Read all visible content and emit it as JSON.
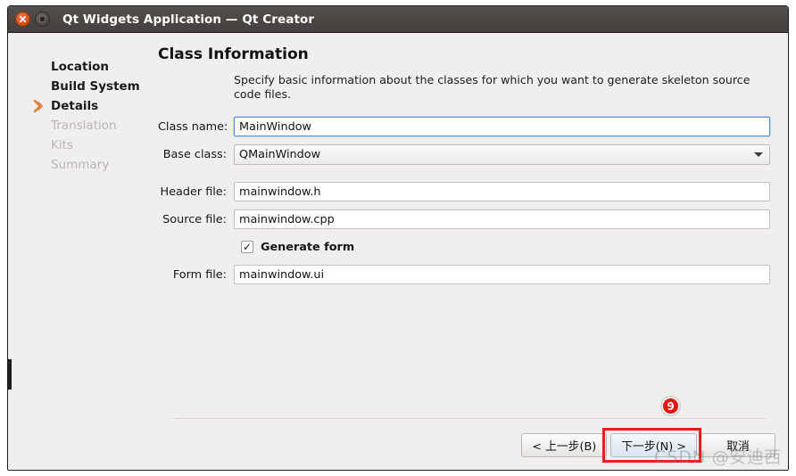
{
  "window": {
    "title": "Qt Widgets Application — Qt Creator",
    "close_icon": "close-icon",
    "minmax_icon": "maximize-icon"
  },
  "sidebar": {
    "items": [
      {
        "label": "Location",
        "state": "done"
      },
      {
        "label": "Build System",
        "state": "done"
      },
      {
        "label": "Details",
        "state": "current"
      },
      {
        "label": "Translation",
        "state": "disabled"
      },
      {
        "label": "Kits",
        "state": "disabled"
      },
      {
        "label": "Summary",
        "state": "disabled"
      }
    ]
  },
  "main": {
    "title": "Class Information",
    "description": "Specify basic information about the classes for which you want to generate skeleton source code files.",
    "fields": {
      "class_name": {
        "label": "Class name:",
        "value": "MainWindow"
      },
      "base_class": {
        "label": "Base class:",
        "value": "QMainWindow",
        "dropdown_icon": "chevron-down-icon"
      },
      "header_file": {
        "label": "Header file:",
        "value": "mainwindow.h"
      },
      "source_file": {
        "label": "Source file:",
        "value": "mainwindow.cpp"
      },
      "generate_form": {
        "label": "Generate form",
        "checked": true,
        "tick": "✓"
      },
      "form_file": {
        "label": "Form file:",
        "value": "mainwindow.ui"
      }
    }
  },
  "footer": {
    "back_label": "< 上一步(B)",
    "next_label": "下一步(N) >",
    "cancel_label": "取消"
  },
  "annotation": {
    "step_badge": "9"
  },
  "watermark": {
    "source": "CSDN",
    "author": "@安迪西"
  },
  "colors": {
    "accent_orange": "#e07b39",
    "highlight_red": "#ee1c1c",
    "badge_red": "#e8140f",
    "focus_blue": "#5294d0",
    "titlebar": "#4b4743"
  }
}
